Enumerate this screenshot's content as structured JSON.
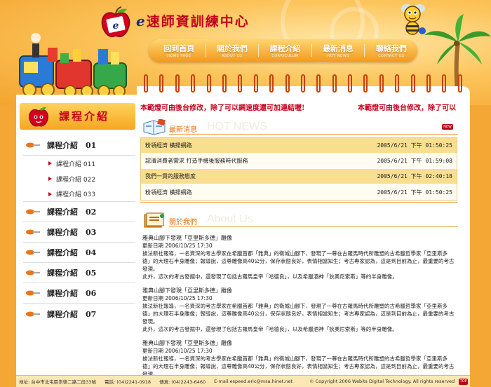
{
  "brand": {
    "prefix": "e",
    "name": "速師資訓練中心"
  },
  "nav": [
    {
      "label": "回到首頁",
      "sub": "HOME PAGE"
    },
    {
      "label": "關於我們",
      "sub": "ABOUT US"
    },
    {
      "label": "課程介紹",
      "sub": "CURRICULUM"
    },
    {
      "label": "最新消息",
      "sub": "HOT NEWS"
    },
    {
      "label": "聯絡我們",
      "sub": "CONTACT US"
    }
  ],
  "sidebar": {
    "title": "課程介紹",
    "items": [
      {
        "label": "課程介紹　01"
      },
      {
        "label": "課程介紹　02"
      },
      {
        "label": "課程介紹　03"
      },
      {
        "label": "課程介紹　04"
      },
      {
        "label": "課程介紹　05"
      },
      {
        "label": "課程介紹　06"
      },
      {
        "label": "課程介紹　07"
      }
    ],
    "subitems": [
      "課程介紹 011",
      "課程介紹 022",
      "課程介紹 033"
    ]
  },
  "notes": {
    "left": "本範燈可由後台修改，除了可以調速度還可加連結喔!",
    "right": "本範燈可由後台修改，除了可以"
  },
  "news": {
    "title": "最新消息",
    "title_en": "HOT NEWS",
    "badge": "NEW",
    "rows": [
      {
        "title": "粉領經濟 橫掃網路",
        "date": "2005/6/21 下午 01:50:25"
      },
      {
        "title": "認清消費者需求 打造手機後服務時代服務",
        "date": "2005/6/21 下午 01:59:08"
      },
      {
        "title": "我們一貫的服務態度",
        "date": "2005/6/21 下午 02:40:18"
      },
      {
        "title": "粉領經濟 橫掃網路",
        "date": "2005/6/21 下午 01:50:25"
      }
    ]
  },
  "about": {
    "title": "關於我們",
    "title_en": "About Us",
    "articles": [
      {
        "title": "雅典山腳下發現「亞里斯多德」雕像",
        "date": "更新日期 2006/10/25 17:30",
        "body": "據法新社報導，一名資深的考古學家在希臘首都「雅典」的衛城山腳下，發現了一尊在古羅馬時代所雕塑的古希臘哲學家「亞里斯多德」的大理石半身雕像；報導說，這尊雕像高40公分，保存狀態良好，表情相當知生；考古專家認為，這是到目前為止，最重要的考古發現。",
        "extra": "此外，這次的考古發掘中，還發現了包括古羅馬皇帝「哈德良」，以及希臘酒神「狄奧尼索斯」等的半身雕像。"
      },
      {
        "title": "雅典山腳下發現「亞里斯多德」雕像",
        "date": "更新日期 2006/10/25 17:30",
        "body": "據法新社報導，一名資深的考古學家在希臘首都「雅典」的衛城山腳下，發現了一尊在古羅馬時代所雕塑的古希臘哲學家「亞里斯多德」的大理石半身雕像；報導說，這尊雕像高40公分，保存狀態良好，表情相當知生；考古專家認為，這是到目前為止，最重要的考古發現。",
        "extra": "此外，這次的考古發掘中，還發現了包括古羅馬皇帝「哈德良」，以及希臘酒神「狄奧尼索斯」等的半身雕像。"
      },
      {
        "title": "雅典山腳下發現「亞里斯多德」雕像",
        "date": "更新日期 2006/10/25 17:30",
        "body": "據法新社報導，一名資深的考古學家在希臘首都「雅典」的衛城山腳下，發現了一尊在古羅馬時代所雕塑的古希臘哲學家「亞里斯多德」的大理石半身雕像；報導說，這尊雕像高40公分，保存狀態良好，表情相當知生；考古專家認為，這是到目前為止，最重要的考古發現。",
        "extra": ""
      }
    ]
  },
  "footer": {
    "address": "地址: 台中市北屯區崇德二路二段33號",
    "phone": "電話: (04)2241-0918",
    "fax": "傳真: (04)2243-6460",
    "email": "E-mail:espeed.eric@msa.hinet.net",
    "copyright": "© Copyright 2006 Webits Digital Technology. All rights reserved",
    "top": "TOP"
  },
  "colors": {
    "accent": "#c4001a",
    "orange": "#f3a52f",
    "highlight": "#f8de8f"
  },
  "icons": [
    "apple-logo-icon",
    "bee-mascot-icon",
    "palm-tree-icon",
    "toy-train-icon",
    "pushpin-icon",
    "triangle-bullet-icon",
    "news-book-icon",
    "about-book-icon"
  ]
}
